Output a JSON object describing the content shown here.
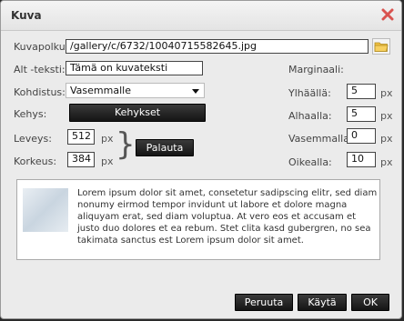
{
  "dialog": {
    "title": "Kuva"
  },
  "form": {
    "path_label": "Kuvapolku:",
    "path_value": "/gallery/c/6732/10040715582645.jpg",
    "alt_label": "Alt -teksti:",
    "alt_value": "Tämä on kuvateksti",
    "align_label": "Kohdistus:",
    "align_value": "Vasemmalle",
    "frame_label": "Kehys:",
    "frame_button": "Kehykset",
    "width_label": "Leveys:",
    "width_value": "512",
    "height_label": "Korkeus:",
    "height_value": "384",
    "px": "px",
    "reset_button": "Palauta"
  },
  "margins": {
    "heading": "Marginaali:",
    "top_label": "Ylhäällä:",
    "top_value": "5",
    "bottom_label": "Alhaalla:",
    "bottom_value": "5",
    "left_label": "Vasemmalla:",
    "left_value": "0",
    "right_label": "Oikealla:",
    "right_value": "10",
    "px": "px"
  },
  "preview": {
    "text": "Lorem ipsum dolor sit amet, consetetur sadipscing elitr, sed diam nonumy eirmod tempor invidunt ut labore et dolore magna aliquyam erat, sed diam voluptua. At vero eos et accusam et justo duo dolores et ea rebum. Stet clita kasd gubergren, no sea takimata sanctus est Lorem ipsum dolor sit amet."
  },
  "footer": {
    "cancel": "Peruuta",
    "apply": "Käytä",
    "ok": "OK"
  },
  "colors": {
    "close_icon": "#d9534f",
    "button_bg": "#1e1e1e"
  }
}
